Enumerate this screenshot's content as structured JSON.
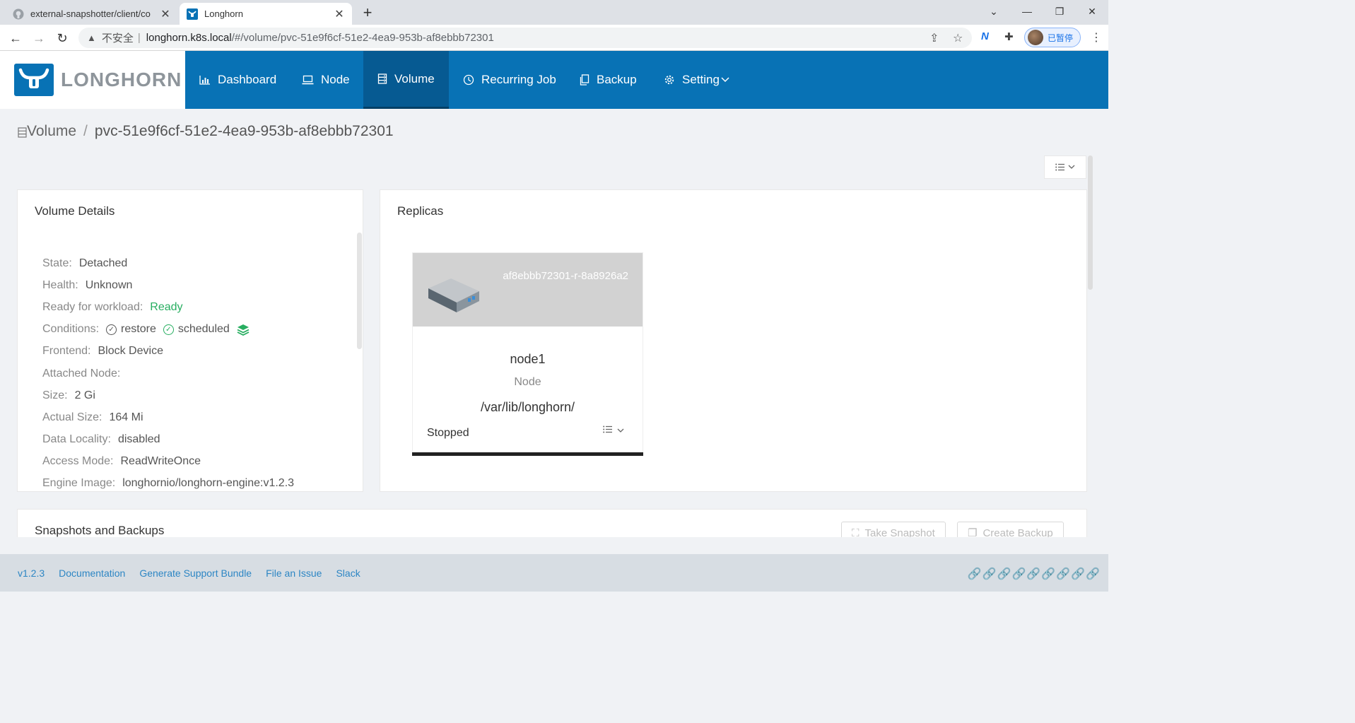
{
  "browser": {
    "tabs": [
      {
        "title": "external-snapshotter/client/co",
        "active": false,
        "icon": "github-icon"
      },
      {
        "title": "Longhorn",
        "active": true,
        "icon": "longhorn-icon"
      }
    ],
    "new_tab": "+",
    "address": {
      "security_label": "不安全",
      "host": "longhorn.k8s.local",
      "path": "/#/volume/pvc-51e9f6cf-51e2-4ea9-953b-af8ebbb72301"
    },
    "profile_label": "已暂停"
  },
  "app": {
    "brand": "LONGHORN",
    "brand_color": "#0872b5",
    "nav": [
      {
        "label": "Dashboard",
        "icon": "bar-chart-icon",
        "active": false
      },
      {
        "label": "Node",
        "icon": "laptop-icon",
        "active": false
      },
      {
        "label": "Volume",
        "icon": "database-icon",
        "active": true
      },
      {
        "label": "Recurring Job",
        "icon": "clock-icon",
        "active": false
      },
      {
        "label": "Backup",
        "icon": "copy-icon",
        "active": false
      },
      {
        "label": "Setting",
        "icon": "gear-icon",
        "active": false
      }
    ]
  },
  "breadcrumb": {
    "root": "Volume",
    "separator": "/",
    "current": "pvc-51e9f6cf-51e2-4ea9-953b-af8ebbb72301"
  },
  "volume_details": {
    "title": "Volume Details",
    "state": {
      "label": "State:",
      "value": "Detached"
    },
    "health": {
      "label": "Health:",
      "value": "Unknown"
    },
    "ready": {
      "label": "Ready for workload:",
      "value": "Ready"
    },
    "conditions": {
      "label": "Conditions:",
      "items": [
        "restore",
        "scheduled"
      ]
    },
    "frontend": {
      "label": "Frontend:",
      "value": "Block Device"
    },
    "attached_node": {
      "label": "Attached Node:",
      "value": ""
    },
    "size": {
      "label": "Size:",
      "value": "2 Gi"
    },
    "actual_size": {
      "label": "Actual Size:",
      "value": "164 Mi"
    },
    "data_locality": {
      "label": "Data Locality:",
      "value": "disabled"
    },
    "access_mode": {
      "label": "Access Mode:",
      "value": "ReadWriteOnce"
    },
    "engine_image": {
      "label": "Engine Image:",
      "value": "longhornio/longhorn-engine:v1.2.3"
    }
  },
  "replicas": {
    "title": "Replicas",
    "items": [
      {
        "name": "af8ebbb72301-r-8a8926a2",
        "node": "node1",
        "node_label": "Node",
        "path": "/var/lib/longhorn/",
        "status": "Stopped"
      }
    ]
  },
  "snapshots": {
    "title": "Snapshots and Backups",
    "take_snapshot": "Take Snapshot",
    "create_backup": "Create Backup"
  },
  "footer": {
    "version": "v1.2.3",
    "documentation": "Documentation",
    "support_bundle": "Generate Support Bundle",
    "file_issue": "File an Issue",
    "slack": "Slack"
  }
}
